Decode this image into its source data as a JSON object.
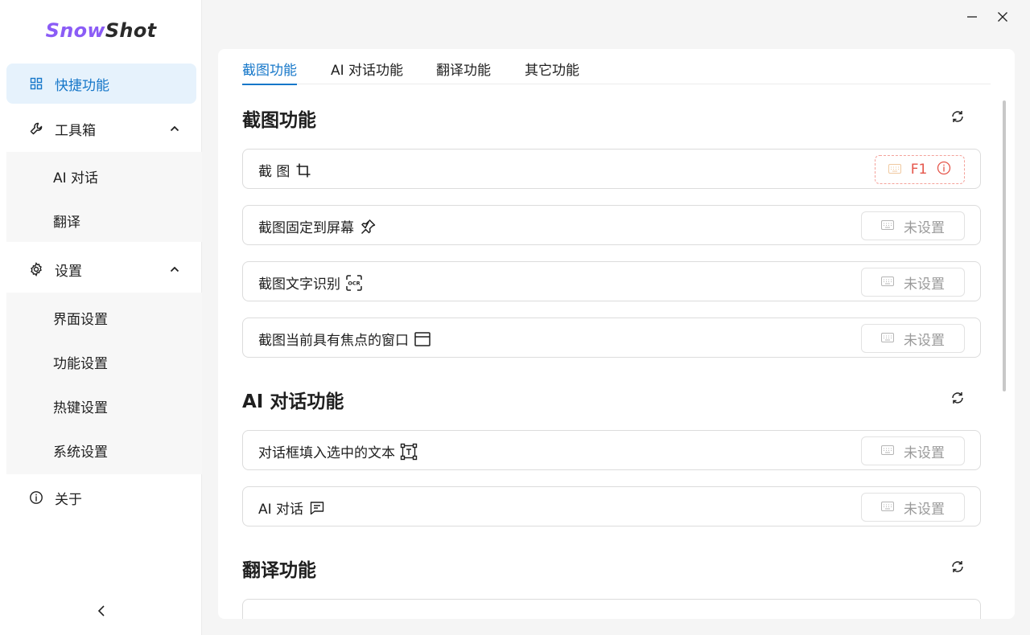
{
  "app": {
    "logo_part1": "Snow",
    "logo_part2": "Shot"
  },
  "sidebar": {
    "items": [
      {
        "label": "快捷功能",
        "icon": "grid-icon"
      },
      {
        "label": "工具箱",
        "icon": "wrench-icon"
      },
      {
        "label": "设置",
        "icon": "gear-icon"
      },
      {
        "label": "关于",
        "icon": "info-icon"
      }
    ],
    "tools_sub": [
      "AI 对话",
      "翻译"
    ],
    "settings_sub": [
      "界面设置",
      "功能设置",
      "热键设置",
      "系统设置"
    ]
  },
  "tabs": [
    "截图功能",
    "AI 对话功能",
    "翻译功能",
    "其它功能"
  ],
  "sections": {
    "screenshot": {
      "title": "截图功能",
      "rows": [
        {
          "label": "截 图",
          "icon": "crop-icon",
          "hotkey": "F1"
        },
        {
          "label": "截图固定到屏幕",
          "icon": "pin-icon",
          "hotkey": "未设置"
        },
        {
          "label": "截图文字识别",
          "icon": "ocr-icon",
          "hotkey": "未设置"
        },
        {
          "label": "截图当前具有焦点的窗口",
          "icon": "window-icon",
          "hotkey": "未设置"
        }
      ]
    },
    "ai_chat": {
      "title": "AI 对话功能",
      "rows": [
        {
          "label": "对话框填入选中的文本",
          "icon": "text-select-icon",
          "hotkey": "未设置"
        },
        {
          "label": "AI 对话",
          "icon": "chat-icon",
          "hotkey": "未设置"
        }
      ]
    },
    "translate": {
      "title": "翻译功能"
    }
  },
  "colors": {
    "accent": "#1677c9",
    "logo": "#8b5cf6",
    "warn": "#e5564b"
  }
}
